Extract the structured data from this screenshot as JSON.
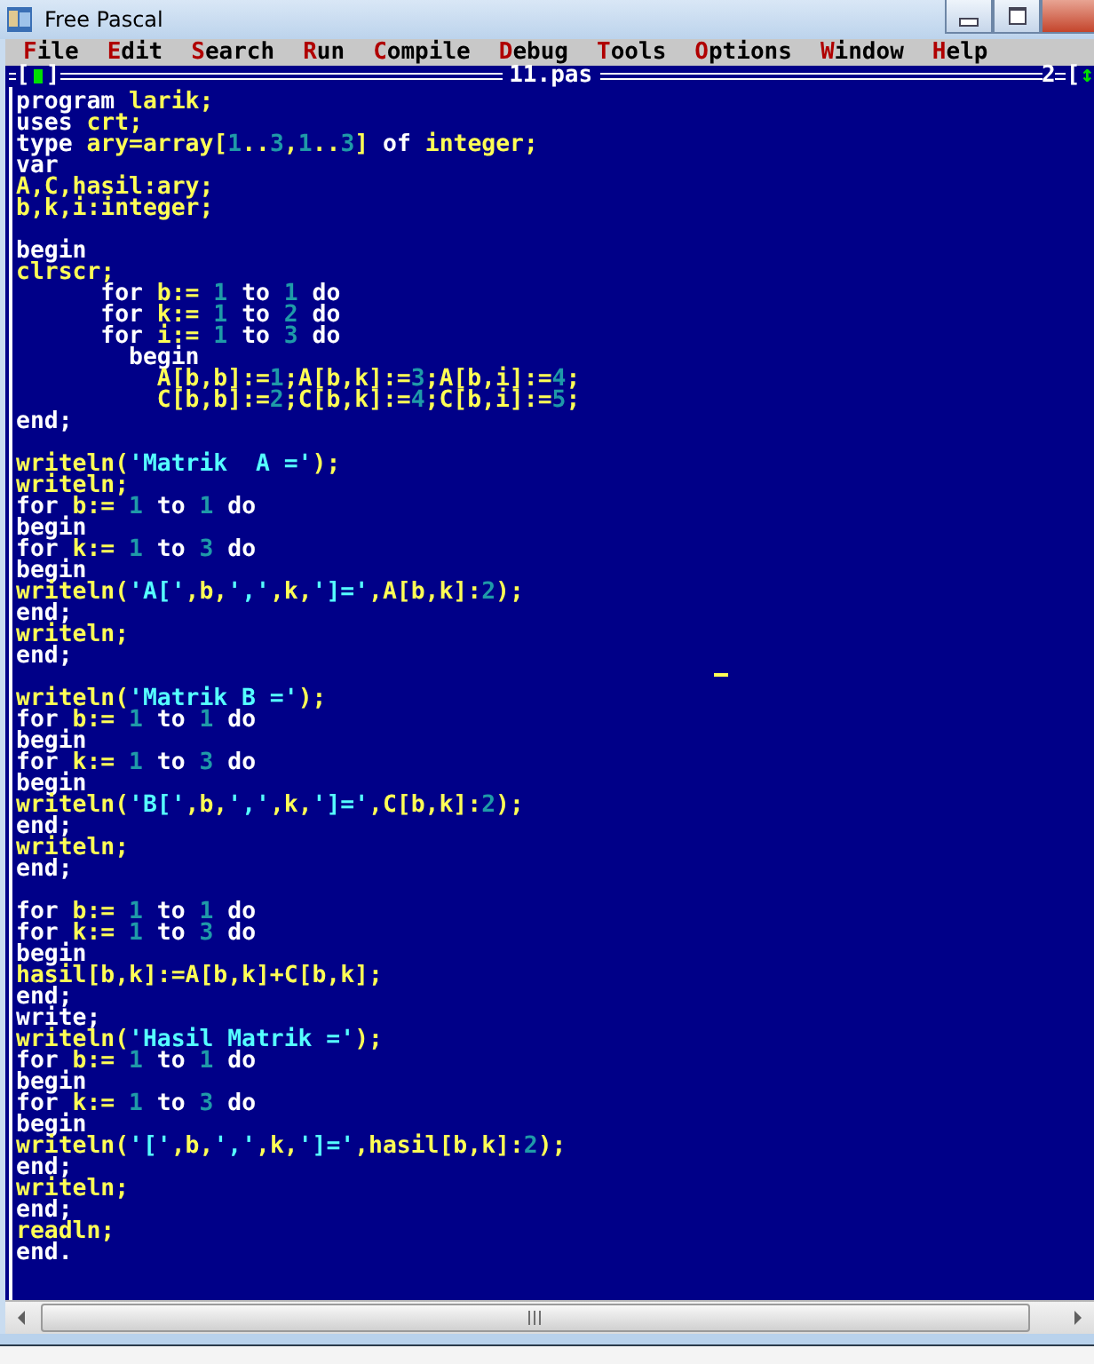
{
  "window": {
    "title": "Free Pascal"
  },
  "menu": [
    {
      "label": "File"
    },
    {
      "label": "Edit"
    },
    {
      "label": "Search"
    },
    {
      "label": "Run"
    },
    {
      "label": "Compile"
    },
    {
      "label": "Debug"
    },
    {
      "label": "Tools"
    },
    {
      "label": "Options"
    },
    {
      "label": "Window"
    },
    {
      "label": "Help"
    }
  ],
  "editor": {
    "close_box": {
      "left": "[",
      "right": "]"
    },
    "title": "11.pas",
    "window_number": "2",
    "zoom_box": "[↕",
    "lines": [
      {
        "kind": "code",
        "tokens": [
          {
            "kind": "keyword",
            "text": "program "
          },
          {
            "kind": "ident",
            "text": "larik;"
          }
        ]
      },
      {
        "kind": "code",
        "tokens": [
          {
            "kind": "keyword",
            "text": "uses "
          },
          {
            "kind": "ident",
            "text": "crt;"
          }
        ]
      },
      {
        "kind": "code",
        "tokens": [
          {
            "kind": "keyword",
            "text": "type "
          },
          {
            "kind": "ident",
            "text": "ary=array["
          },
          {
            "kind": "number",
            "text": "1"
          },
          {
            "kind": "ident",
            "text": ".."
          },
          {
            "kind": "number",
            "text": "3"
          },
          {
            "kind": "ident",
            "text": ","
          },
          {
            "kind": "number",
            "text": "1"
          },
          {
            "kind": "ident",
            "text": ".."
          },
          {
            "kind": "number",
            "text": "3"
          },
          {
            "kind": "ident",
            "text": "] "
          },
          {
            "kind": "keyword",
            "text": "of "
          },
          {
            "kind": "ident",
            "text": "integer;"
          }
        ]
      },
      {
        "kind": "code",
        "tokens": [
          {
            "kind": "keyword",
            "text": "var"
          }
        ]
      },
      {
        "kind": "code",
        "tokens": [
          {
            "kind": "ident",
            "text": "A,C,hasil:ary;"
          }
        ]
      },
      {
        "kind": "code",
        "tokens": [
          {
            "kind": "ident",
            "text": "b,k,i:integer;"
          }
        ]
      },
      {
        "kind": "blank"
      },
      {
        "kind": "code",
        "tokens": [
          {
            "kind": "keyword",
            "text": "begin"
          }
        ]
      },
      {
        "kind": "code",
        "tokens": [
          {
            "kind": "ident",
            "text": "clrscr;"
          }
        ]
      },
      {
        "kind": "code",
        "tokens": [
          {
            "kind": "keyword",
            "text": "      for "
          },
          {
            "kind": "ident",
            "text": "b:= "
          },
          {
            "kind": "number",
            "text": "1"
          },
          {
            "kind": "keyword",
            "text": " to "
          },
          {
            "kind": "number",
            "text": "1"
          },
          {
            "kind": "keyword",
            "text": " do"
          }
        ]
      },
      {
        "kind": "code",
        "tokens": [
          {
            "kind": "keyword",
            "text": "      for "
          },
          {
            "kind": "ident",
            "text": "k:= "
          },
          {
            "kind": "number",
            "text": "1"
          },
          {
            "kind": "keyword",
            "text": " to "
          },
          {
            "kind": "number",
            "text": "2"
          },
          {
            "kind": "keyword",
            "text": " do"
          }
        ]
      },
      {
        "kind": "code",
        "tokens": [
          {
            "kind": "keyword",
            "text": "      for "
          },
          {
            "kind": "ident",
            "text": "i:= "
          },
          {
            "kind": "number",
            "text": "1"
          },
          {
            "kind": "keyword",
            "text": " to "
          },
          {
            "kind": "number",
            "text": "3"
          },
          {
            "kind": "keyword",
            "text": " do"
          }
        ]
      },
      {
        "kind": "code",
        "tokens": [
          {
            "kind": "keyword",
            "text": "        begin"
          }
        ]
      },
      {
        "kind": "code",
        "tokens": [
          {
            "kind": "ident",
            "text": "          A[b,b]:="
          },
          {
            "kind": "number",
            "text": "1"
          },
          {
            "kind": "ident",
            "text": ";A[b,k]:="
          },
          {
            "kind": "number",
            "text": "3"
          },
          {
            "kind": "ident",
            "text": ";A[b,i]:="
          },
          {
            "kind": "number",
            "text": "4"
          },
          {
            "kind": "ident",
            "text": ";"
          }
        ]
      },
      {
        "kind": "code",
        "tokens": [
          {
            "kind": "ident",
            "text": "          C[b,b]:="
          },
          {
            "kind": "number",
            "text": "2"
          },
          {
            "kind": "ident",
            "text": ";C[b,k]:="
          },
          {
            "kind": "number",
            "text": "4"
          },
          {
            "kind": "ident",
            "text": ";C[b,i]:="
          },
          {
            "kind": "number",
            "text": "5"
          },
          {
            "kind": "ident",
            "text": ";"
          }
        ]
      },
      {
        "kind": "code",
        "tokens": [
          {
            "kind": "keyword",
            "text": "end;"
          }
        ]
      },
      {
        "kind": "blank"
      },
      {
        "kind": "code",
        "tokens": [
          {
            "kind": "ident",
            "text": "writeln("
          },
          {
            "kind": "string",
            "text": "'Matrik  A ='"
          },
          {
            "kind": "ident",
            "text": ");"
          }
        ]
      },
      {
        "kind": "code",
        "tokens": [
          {
            "kind": "ident",
            "text": "writeln;"
          }
        ]
      },
      {
        "kind": "code",
        "tokens": [
          {
            "kind": "keyword",
            "text": "for "
          },
          {
            "kind": "ident",
            "text": "b:= "
          },
          {
            "kind": "number",
            "text": "1"
          },
          {
            "kind": "keyword",
            "text": " to "
          },
          {
            "kind": "number",
            "text": "1"
          },
          {
            "kind": "keyword",
            "text": " do"
          }
        ]
      },
      {
        "kind": "code",
        "tokens": [
          {
            "kind": "keyword",
            "text": "begin"
          }
        ]
      },
      {
        "kind": "code",
        "tokens": [
          {
            "kind": "keyword",
            "text": "for "
          },
          {
            "kind": "ident",
            "text": "k:= "
          },
          {
            "kind": "number",
            "text": "1"
          },
          {
            "kind": "keyword",
            "text": " to "
          },
          {
            "kind": "number",
            "text": "3"
          },
          {
            "kind": "keyword",
            "text": " do"
          }
        ]
      },
      {
        "kind": "code",
        "tokens": [
          {
            "kind": "keyword",
            "text": "begin"
          }
        ]
      },
      {
        "kind": "code",
        "tokens": [
          {
            "kind": "ident",
            "text": "writeln("
          },
          {
            "kind": "string",
            "text": "'A['"
          },
          {
            "kind": "ident",
            "text": ",b,"
          },
          {
            "kind": "string",
            "text": "','"
          },
          {
            "kind": "ident",
            "text": ",k,"
          },
          {
            "kind": "string",
            "text": "']='"
          },
          {
            "kind": "ident",
            "text": ",A[b,k]:"
          },
          {
            "kind": "number",
            "text": "2"
          },
          {
            "kind": "ident",
            "text": ");"
          }
        ]
      },
      {
        "kind": "code",
        "tokens": [
          {
            "kind": "keyword",
            "text": "end;"
          }
        ]
      },
      {
        "kind": "code",
        "tokens": [
          {
            "kind": "ident",
            "text": "writeln;"
          }
        ]
      },
      {
        "kind": "code",
        "tokens": [
          {
            "kind": "keyword",
            "text": "end;"
          }
        ]
      },
      {
        "kind": "blank"
      },
      {
        "kind": "code",
        "tokens": [
          {
            "kind": "ident",
            "text": "writeln("
          },
          {
            "kind": "string",
            "text": "'Matrik B ='"
          },
          {
            "kind": "ident",
            "text": ");"
          }
        ]
      },
      {
        "kind": "code",
        "tokens": [
          {
            "kind": "keyword",
            "text": "for "
          },
          {
            "kind": "ident",
            "text": "b:= "
          },
          {
            "kind": "number",
            "text": "1"
          },
          {
            "kind": "keyword",
            "text": " to "
          },
          {
            "kind": "number",
            "text": "1"
          },
          {
            "kind": "keyword",
            "text": " do"
          }
        ]
      },
      {
        "kind": "code",
        "tokens": [
          {
            "kind": "keyword",
            "text": "begin"
          }
        ]
      },
      {
        "kind": "code",
        "tokens": [
          {
            "kind": "keyword",
            "text": "for "
          },
          {
            "kind": "ident",
            "text": "k:= "
          },
          {
            "kind": "number",
            "text": "1"
          },
          {
            "kind": "keyword",
            "text": " to "
          },
          {
            "kind": "number",
            "text": "3"
          },
          {
            "kind": "keyword",
            "text": " do"
          }
        ]
      },
      {
        "kind": "code",
        "tokens": [
          {
            "kind": "keyword",
            "text": "begin"
          }
        ]
      },
      {
        "kind": "code",
        "tokens": [
          {
            "kind": "ident",
            "text": "writeln("
          },
          {
            "kind": "string",
            "text": "'B['"
          },
          {
            "kind": "ident",
            "text": ",b,"
          },
          {
            "kind": "string",
            "text": "','"
          },
          {
            "kind": "ident",
            "text": ",k,"
          },
          {
            "kind": "string",
            "text": "']='"
          },
          {
            "kind": "ident",
            "text": ",C[b,k]:"
          },
          {
            "kind": "number",
            "text": "2"
          },
          {
            "kind": "ident",
            "text": ");"
          }
        ]
      },
      {
        "kind": "code",
        "tokens": [
          {
            "kind": "keyword",
            "text": "end;"
          }
        ]
      },
      {
        "kind": "code",
        "tokens": [
          {
            "kind": "ident",
            "text": "writeln;"
          }
        ]
      },
      {
        "kind": "code",
        "tokens": [
          {
            "kind": "keyword",
            "text": "end;"
          }
        ]
      },
      {
        "kind": "blank"
      },
      {
        "kind": "code",
        "tokens": [
          {
            "kind": "keyword",
            "text": "for "
          },
          {
            "kind": "ident",
            "text": "b:= "
          },
          {
            "kind": "number",
            "text": "1"
          },
          {
            "kind": "keyword",
            "text": " to "
          },
          {
            "kind": "number",
            "text": "1"
          },
          {
            "kind": "keyword",
            "text": " do"
          }
        ]
      },
      {
        "kind": "code",
        "tokens": [
          {
            "kind": "keyword",
            "text": "for "
          },
          {
            "kind": "ident",
            "text": "k:= "
          },
          {
            "kind": "number",
            "text": "1"
          },
          {
            "kind": "keyword",
            "text": " to "
          },
          {
            "kind": "number",
            "text": "3"
          },
          {
            "kind": "keyword",
            "text": " do"
          }
        ]
      },
      {
        "kind": "code",
        "tokens": [
          {
            "kind": "keyword",
            "text": "begin"
          }
        ]
      },
      {
        "kind": "code",
        "tokens": [
          {
            "kind": "ident",
            "text": "hasil[b,k]:=A[b,k]+C[b,k];"
          }
        ]
      },
      {
        "kind": "code",
        "tokens": [
          {
            "kind": "keyword",
            "text": "end;"
          }
        ]
      },
      {
        "kind": "code",
        "tokens": [
          {
            "kind": "keyword",
            "text": "write;"
          }
        ]
      },
      {
        "kind": "code",
        "tokens": [
          {
            "kind": "ident",
            "text": "writeln("
          },
          {
            "kind": "string",
            "text": "'Hasil Matrik ='"
          },
          {
            "kind": "ident",
            "text": ");"
          }
        ]
      },
      {
        "kind": "code",
        "tokens": [
          {
            "kind": "keyword",
            "text": "for "
          },
          {
            "kind": "ident",
            "text": "b:= "
          },
          {
            "kind": "number",
            "text": "1"
          },
          {
            "kind": "keyword",
            "text": " to "
          },
          {
            "kind": "number",
            "text": "1"
          },
          {
            "kind": "keyword",
            "text": " do"
          }
        ]
      },
      {
        "kind": "code",
        "tokens": [
          {
            "kind": "keyword",
            "text": "begin"
          }
        ]
      },
      {
        "kind": "code",
        "tokens": [
          {
            "kind": "keyword",
            "text": "for "
          },
          {
            "kind": "ident",
            "text": "k:= "
          },
          {
            "kind": "number",
            "text": "1"
          },
          {
            "kind": "keyword",
            "text": " to "
          },
          {
            "kind": "number",
            "text": "3"
          },
          {
            "kind": "keyword",
            "text": " do"
          }
        ]
      },
      {
        "kind": "code",
        "tokens": [
          {
            "kind": "keyword",
            "text": "begin"
          }
        ]
      },
      {
        "kind": "code",
        "tokens": [
          {
            "kind": "ident",
            "text": "writeln("
          },
          {
            "kind": "string",
            "text": "'['"
          },
          {
            "kind": "ident",
            "text": ",b,"
          },
          {
            "kind": "string",
            "text": "','"
          },
          {
            "kind": "ident",
            "text": ",k,"
          },
          {
            "kind": "string",
            "text": "']='"
          },
          {
            "kind": "ident",
            "text": ",hasil[b,k]:"
          },
          {
            "kind": "number",
            "text": "2"
          },
          {
            "kind": "ident",
            "text": ");"
          }
        ]
      },
      {
        "kind": "code",
        "tokens": [
          {
            "kind": "keyword",
            "text": "end;"
          }
        ]
      },
      {
        "kind": "code",
        "tokens": [
          {
            "kind": "ident",
            "text": "writeln;"
          }
        ]
      },
      {
        "kind": "code",
        "tokens": [
          {
            "kind": "keyword",
            "text": "end;"
          }
        ]
      },
      {
        "kind": "code",
        "tokens": [
          {
            "kind": "ident",
            "text": "readln;"
          }
        ]
      },
      {
        "kind": "code",
        "tokens": [
          {
            "kind": "keyword",
            "text": "end."
          }
        ]
      }
    ]
  }
}
